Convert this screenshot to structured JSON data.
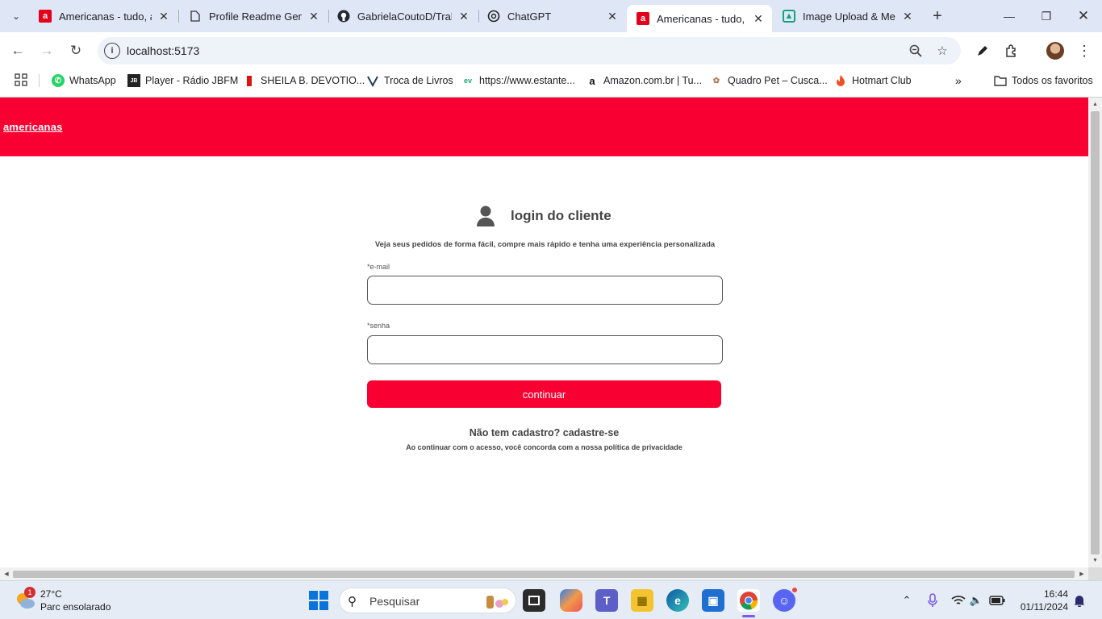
{
  "browser": {
    "tabs": [
      {
        "title": "Americanas - tudo, a um clique",
        "favicon": "americanas-icon",
        "active": false
      },
      {
        "title": "Profile Readme Generator",
        "favicon": "document-icon",
        "active": false
      },
      {
        "title": "GabrielaCoutoD/Trabalho",
        "favicon": "github-icon",
        "active": false
      },
      {
        "title": "ChatGPT",
        "favicon": "chatgpt-icon",
        "active": false
      },
      {
        "title": "Americanas - tudo, a um clique",
        "favicon": "americanas-icon",
        "active": true
      },
      {
        "title": "Image Upload & Merge",
        "favicon": "image-upload-icon",
        "active": false
      }
    ],
    "url": "localhost:5173",
    "bookmarks": [
      {
        "label": "WhatsApp",
        "icon": "whatsapp-icon"
      },
      {
        "label": "Player - Rádio JBFM",
        "icon": "jbfm-icon"
      },
      {
        "label": "SHEILA B. DEVOTIO...",
        "icon": "sheila-icon"
      },
      {
        "label": "Troca de Livros",
        "icon": "book-exchange-icon"
      },
      {
        "label": "https://www.estante...",
        "icon": "estante-icon"
      },
      {
        "label": "Amazon.com.br | Tu...",
        "icon": "amazon-icon"
      },
      {
        "label": "Quadro Pet – Cusca...",
        "icon": "pet-icon"
      },
      {
        "label": "Hotmart Club",
        "icon": "hotmart-icon"
      }
    ],
    "all_bookmarks_label": "Todos os favoritos"
  },
  "site": {
    "logo": "americanas",
    "brand_color": "#f80032"
  },
  "login": {
    "title": "login do cliente",
    "subtitle": "Veja seus pedidos de forma fácil, compre mais rápido e tenha uma experiência personalizada",
    "email_label": "*e-mail",
    "email_value": "",
    "password_label": "*senha",
    "password_value": "",
    "continue_label": "continuar",
    "signup_text": "Não tem cadastro? cadastre-se",
    "privacy_text": "Ao continuar com o acesso, você concorda com a nossa política de privacidade"
  },
  "taskbar": {
    "weather_temp": "27°C",
    "weather_desc": "Parc ensolarado",
    "weather_badge": "1",
    "search_placeholder": "Pesquisar",
    "time": "16:44",
    "date": "01/11/2024"
  }
}
